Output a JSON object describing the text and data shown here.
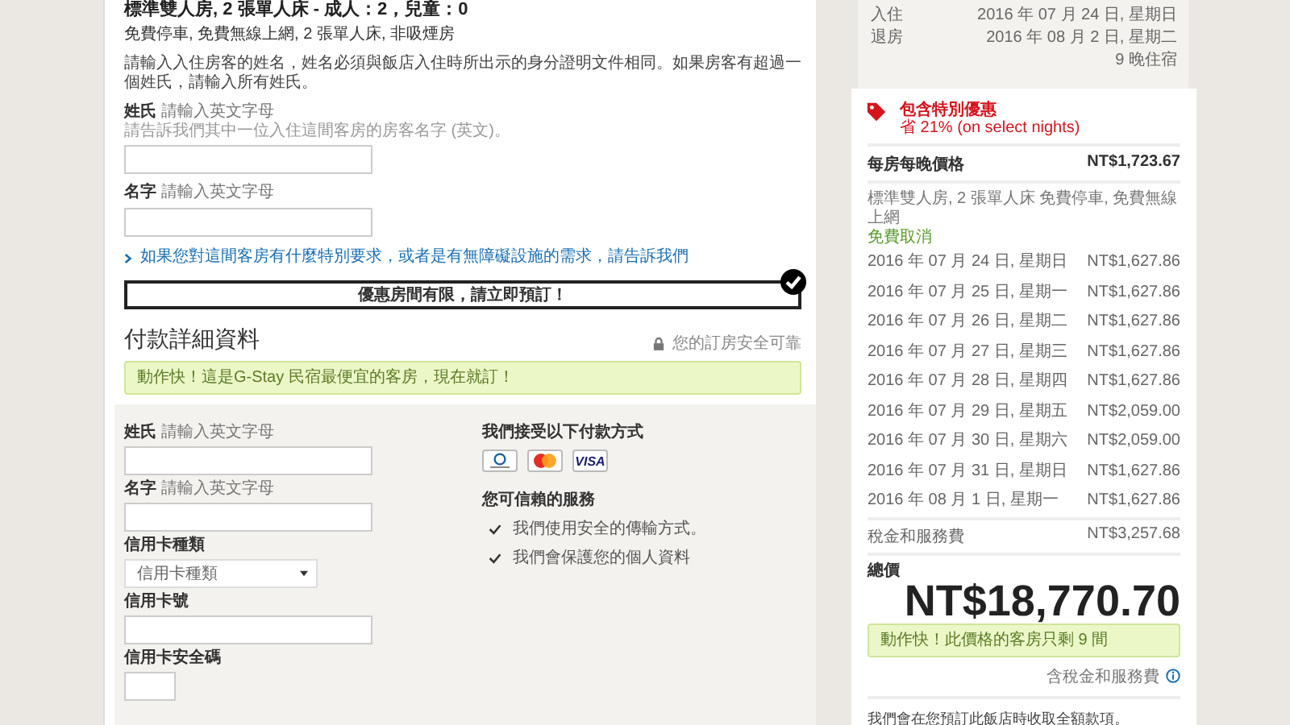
{
  "room": {
    "title": "標準雙人房, 2 張單人床 - 成人：2，兒童：0",
    "features": "免費停車, 免費無線上網, 2 張單人床, 非吸煙房",
    "instructions": "請輸入入住房客的姓名，姓名必須與飯店入住時所出示的身分證明文件相同。如果房客有超過一個姓氏，請輸入所有姓氏。",
    "guest_fields": [
      {
        "label": "姓氏",
        "hint": "請輸入英文字母",
        "note": "請告訴我們其中一位入住這間客房的房客名字 (英文)。"
      },
      {
        "label": "名字",
        "hint": "請輸入英文字母"
      }
    ],
    "special_request_link": "如果您對這間客房有什麼特別要求，或者是有無障礙設施的需求，請告訴我們"
  },
  "urgency_banner": {
    "text": "優惠房間有限，請立即預訂！",
    "checked": true
  },
  "payment": {
    "title": "付款詳細資料",
    "secure_note": "您的訂房安全可靠",
    "alert": "動作快！這是G-Stay 民宿最便宜的客房，現在就訂！",
    "fields": [
      {
        "kind": "text",
        "label": "姓氏",
        "hint": "請輸入英文字母"
      },
      {
        "kind": "text",
        "label": "名字",
        "hint": "請輸入英文字母"
      },
      {
        "kind": "select",
        "label": "信用卡種類",
        "placeholder": "信用卡種類"
      },
      {
        "kind": "text",
        "label": "信用卡號"
      },
      {
        "kind": "short",
        "label": "信用卡安全碼"
      }
    ],
    "accepted": {
      "title": "我們接受以下付款方式",
      "cards": [
        {
          "kind": "diners"
        },
        {
          "kind": "mastercard"
        },
        {
          "kind": "visa",
          "label": "VISA"
        }
      ]
    },
    "trust": {
      "title": "您可信賴的服務",
      "items": [
        "我們使用安全的傳輸方式。",
        "我們會保護您的個人資料"
      ]
    }
  },
  "summary": {
    "stay": [
      {
        "label": "入住",
        "value": "2016 年 07 月 24 日, 星期日"
      },
      {
        "label": "退房",
        "value": "2016 年 08 月 2 日, 星期二"
      }
    ],
    "nights": "9 晚住宿",
    "deal": {
      "title": "包含特別優惠",
      "saving": "省 21% (on select nights)"
    },
    "rate": {
      "label": "每房每晚價格",
      "value": "NT$1,723.67"
    },
    "room_desc": "標準雙人房, 2 張單人床 免費停車, 免費無線上網",
    "cancellation": "免費取消",
    "nightly": [
      {
        "date": "2016 年 07 月 24 日, 星期日",
        "price": "NT$1,627.86"
      },
      {
        "date": "2016 年 07 月 25 日, 星期一",
        "price": "NT$1,627.86"
      },
      {
        "date": "2016 年 07 月 26 日, 星期二",
        "price": "NT$1,627.86"
      },
      {
        "date": "2016 年 07 月 27 日, 星期三",
        "price": "NT$1,627.86"
      },
      {
        "date": "2016 年 07 月 28 日, 星期四",
        "price": "NT$1,627.86"
      },
      {
        "date": "2016 年 07 月 29 日, 星期五",
        "price": "NT$2,059.00"
      },
      {
        "date": "2016 年 07 月 30 日, 星期六",
        "price": "NT$2,059.00"
      },
      {
        "date": "2016 年 07 月 31 日, 星期日",
        "price": "NT$1,627.86"
      },
      {
        "date": "2016 年 08 月 1 日, 星期一",
        "price": "NT$1,627.86"
      }
    ],
    "tax": {
      "label": "稅金和服務費",
      "value": "NT$3,257.68"
    },
    "total": {
      "label": "總價",
      "amount": "NT$18,770.70"
    },
    "scarcity": "動作快！此價格的客房只剩 9 間",
    "tax_note": "含稅金和服務費",
    "payment_note": "我們會在您預訂此飯店時收取全額款項。"
  }
}
